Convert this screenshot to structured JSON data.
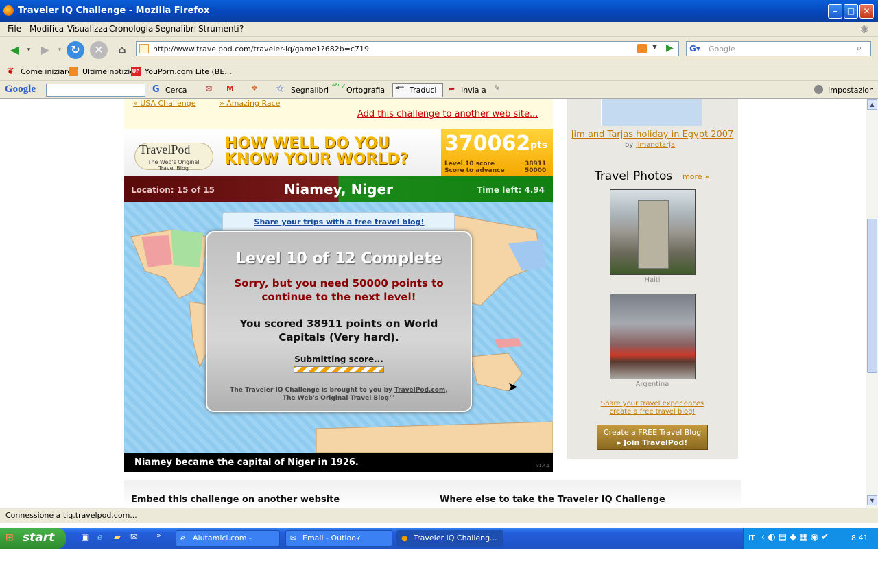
{
  "window": {
    "title": "Traveler IQ Challenge - Mozilla Firefox"
  },
  "menu": [
    "File",
    "Modifica",
    "Visualizza",
    "Cronologia",
    "Segnalibri",
    "Strumenti",
    "?"
  ],
  "nav": {
    "url": "http://www.travelpod.com/traveler-iq/game1?682b=c719",
    "search_placeholder": "Google"
  },
  "bookmarks": [
    "Come iniziare",
    "Ultime notizie",
    "YouPorn.com Lite (BE..."
  ],
  "google_toolbar": {
    "logo": "Google",
    "cerca": "Cerca",
    "segnalibri": "Segnalibri",
    "ortografia": "Ortografia",
    "traduci": "Traduci",
    "invia": "Invia a",
    "impostazioni": "Impostazioni"
  },
  "page": {
    "links_top": [
      "USA Challenge",
      "Amazing Race"
    ],
    "add_link": "Add this challenge to another web site...",
    "travelpod_logo": "TravelPod",
    "travelpod_tagline": "The Web's Original Travel Blog",
    "game_title": "HOW WELL DO YOU KNOW YOUR WORLD?",
    "score": {
      "value": "370062",
      "unit": "pts",
      "level_label": "Level 10 score",
      "level_value": "38911",
      "advance_label": "Score to advance",
      "advance_value": "50000"
    },
    "location_label": "Location: 15 of 15",
    "city": "Niamey, Niger",
    "time_left": "Time left: 4.94",
    "share_link": "Share your trips with a free travel blog!",
    "modal": {
      "title": "Level 10 of 12 Complete",
      "sorry": "Sorry, but you need 50000 points to continue to the next level!",
      "scored": "You scored 38911 points on World Capitals (Very hard).",
      "submitting": "Submitting score...",
      "credit_prefix": "The Traveler IQ Challenge is brought to you by",
      "credit_link": "TravelPod.com",
      "credit_suffix": "The Web's Original Travel Blog™"
    },
    "fact": "Niamey became the capital of Niger in 1926.",
    "version": "v1.4.1",
    "embed_heading": "Embed this challenge on another website",
    "where_heading": "Where else to take the Traveler IQ Challenge"
  },
  "sidebar": {
    "blog_link": "Jim and Tarjas holiday in Egypt 2007",
    "by": "by",
    "author": "jimandtarja",
    "photos_heading": "Travel Photos",
    "more": "more »",
    "photos": [
      {
        "caption": "Haiti"
      },
      {
        "caption": "Argentina"
      }
    ],
    "share_line1": "Share your travel experiences",
    "share_line2": "create a free travel blog!",
    "cta_line1": "Create a FREE Travel Blog",
    "cta_line2": "Join TravelPod!"
  },
  "status": "Connessione a tiq.travelpod.com...",
  "taskbar": {
    "start": "start",
    "items": [
      "Aiutamici.com - Wind...",
      "Email - Outlook Express",
      "Traveler IQ Challeng..."
    ],
    "lang": "IT",
    "clock": "8.41"
  }
}
